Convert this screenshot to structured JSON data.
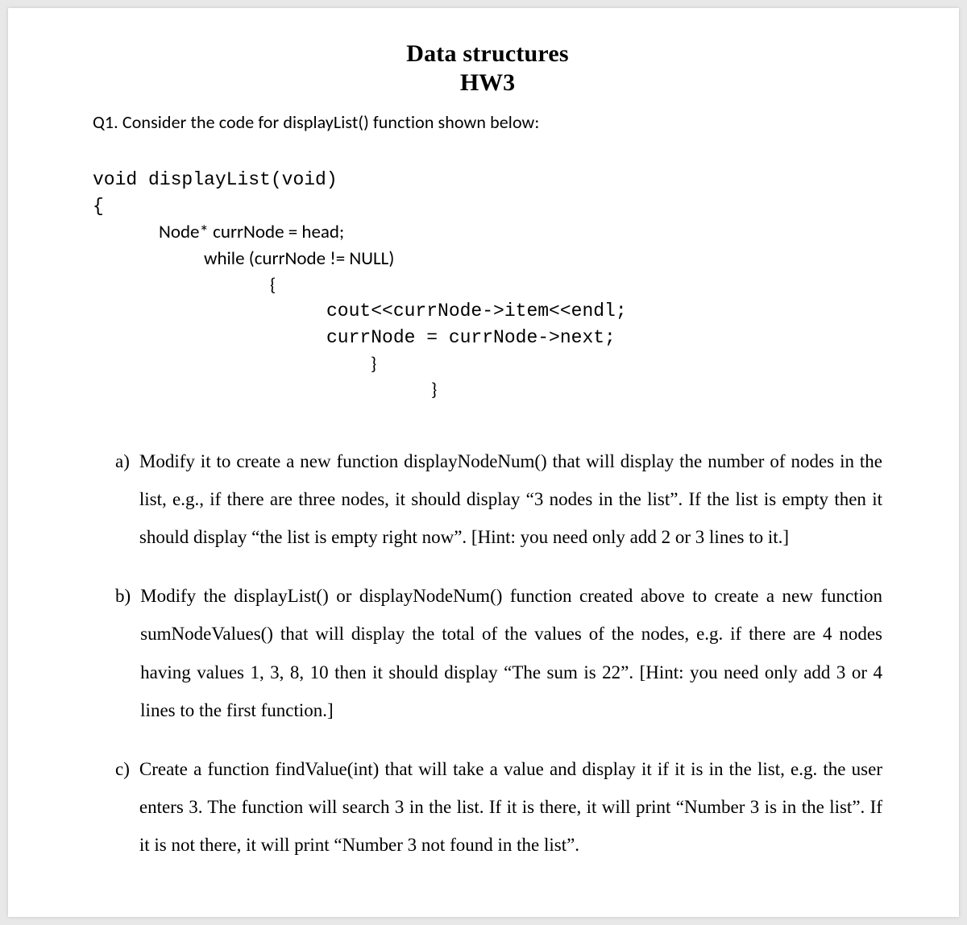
{
  "header": {
    "title": "Data structures",
    "subtitle": "HW3"
  },
  "q1_intro": "Q1. Consider the code for displayList() function shown below:",
  "code": {
    "l1": "void displayList(void)",
    "l2": "{",
    "l3": "Node* currNode = head;",
    "l4": "while (currNode != NULL)",
    "l5": "{",
    "l6": "cout<<currNode->item<<endl;",
    "l7": "currNode = currNode->next;",
    "l8": "}",
    "l9": "}"
  },
  "questions": {
    "a": {
      "marker": "a)",
      "text": "Modify it to create a new function displayNodeNum() that will display the number of nodes in the list, e.g., if there are three nodes, it should display “3 nodes in the list”. If the list is empty then it should display “the list is empty right now”. [Hint: you need only add 2 or 3 lines to it.]"
    },
    "b": {
      "marker": "b)",
      "text": "Modify the displayList() or displayNodeNum() function created above to create a new function sumNodeValues() that will display the total of the values of the nodes, e.g. if there are 4 nodes having values 1, 3, 8, 10 then it should display “The sum is 22”. [Hint: you need only add 3 or 4 lines to the first function.]"
    },
    "c": {
      "marker": "c)",
      "text": "Create a function findValue(int) that will take a value and display it if it is in the list, e.g. the user enters 3. The function will search 3 in the list. If it is there, it will print “Number 3 is in the list”. If it is not there, it will print “Number 3 not found in the list”."
    }
  }
}
